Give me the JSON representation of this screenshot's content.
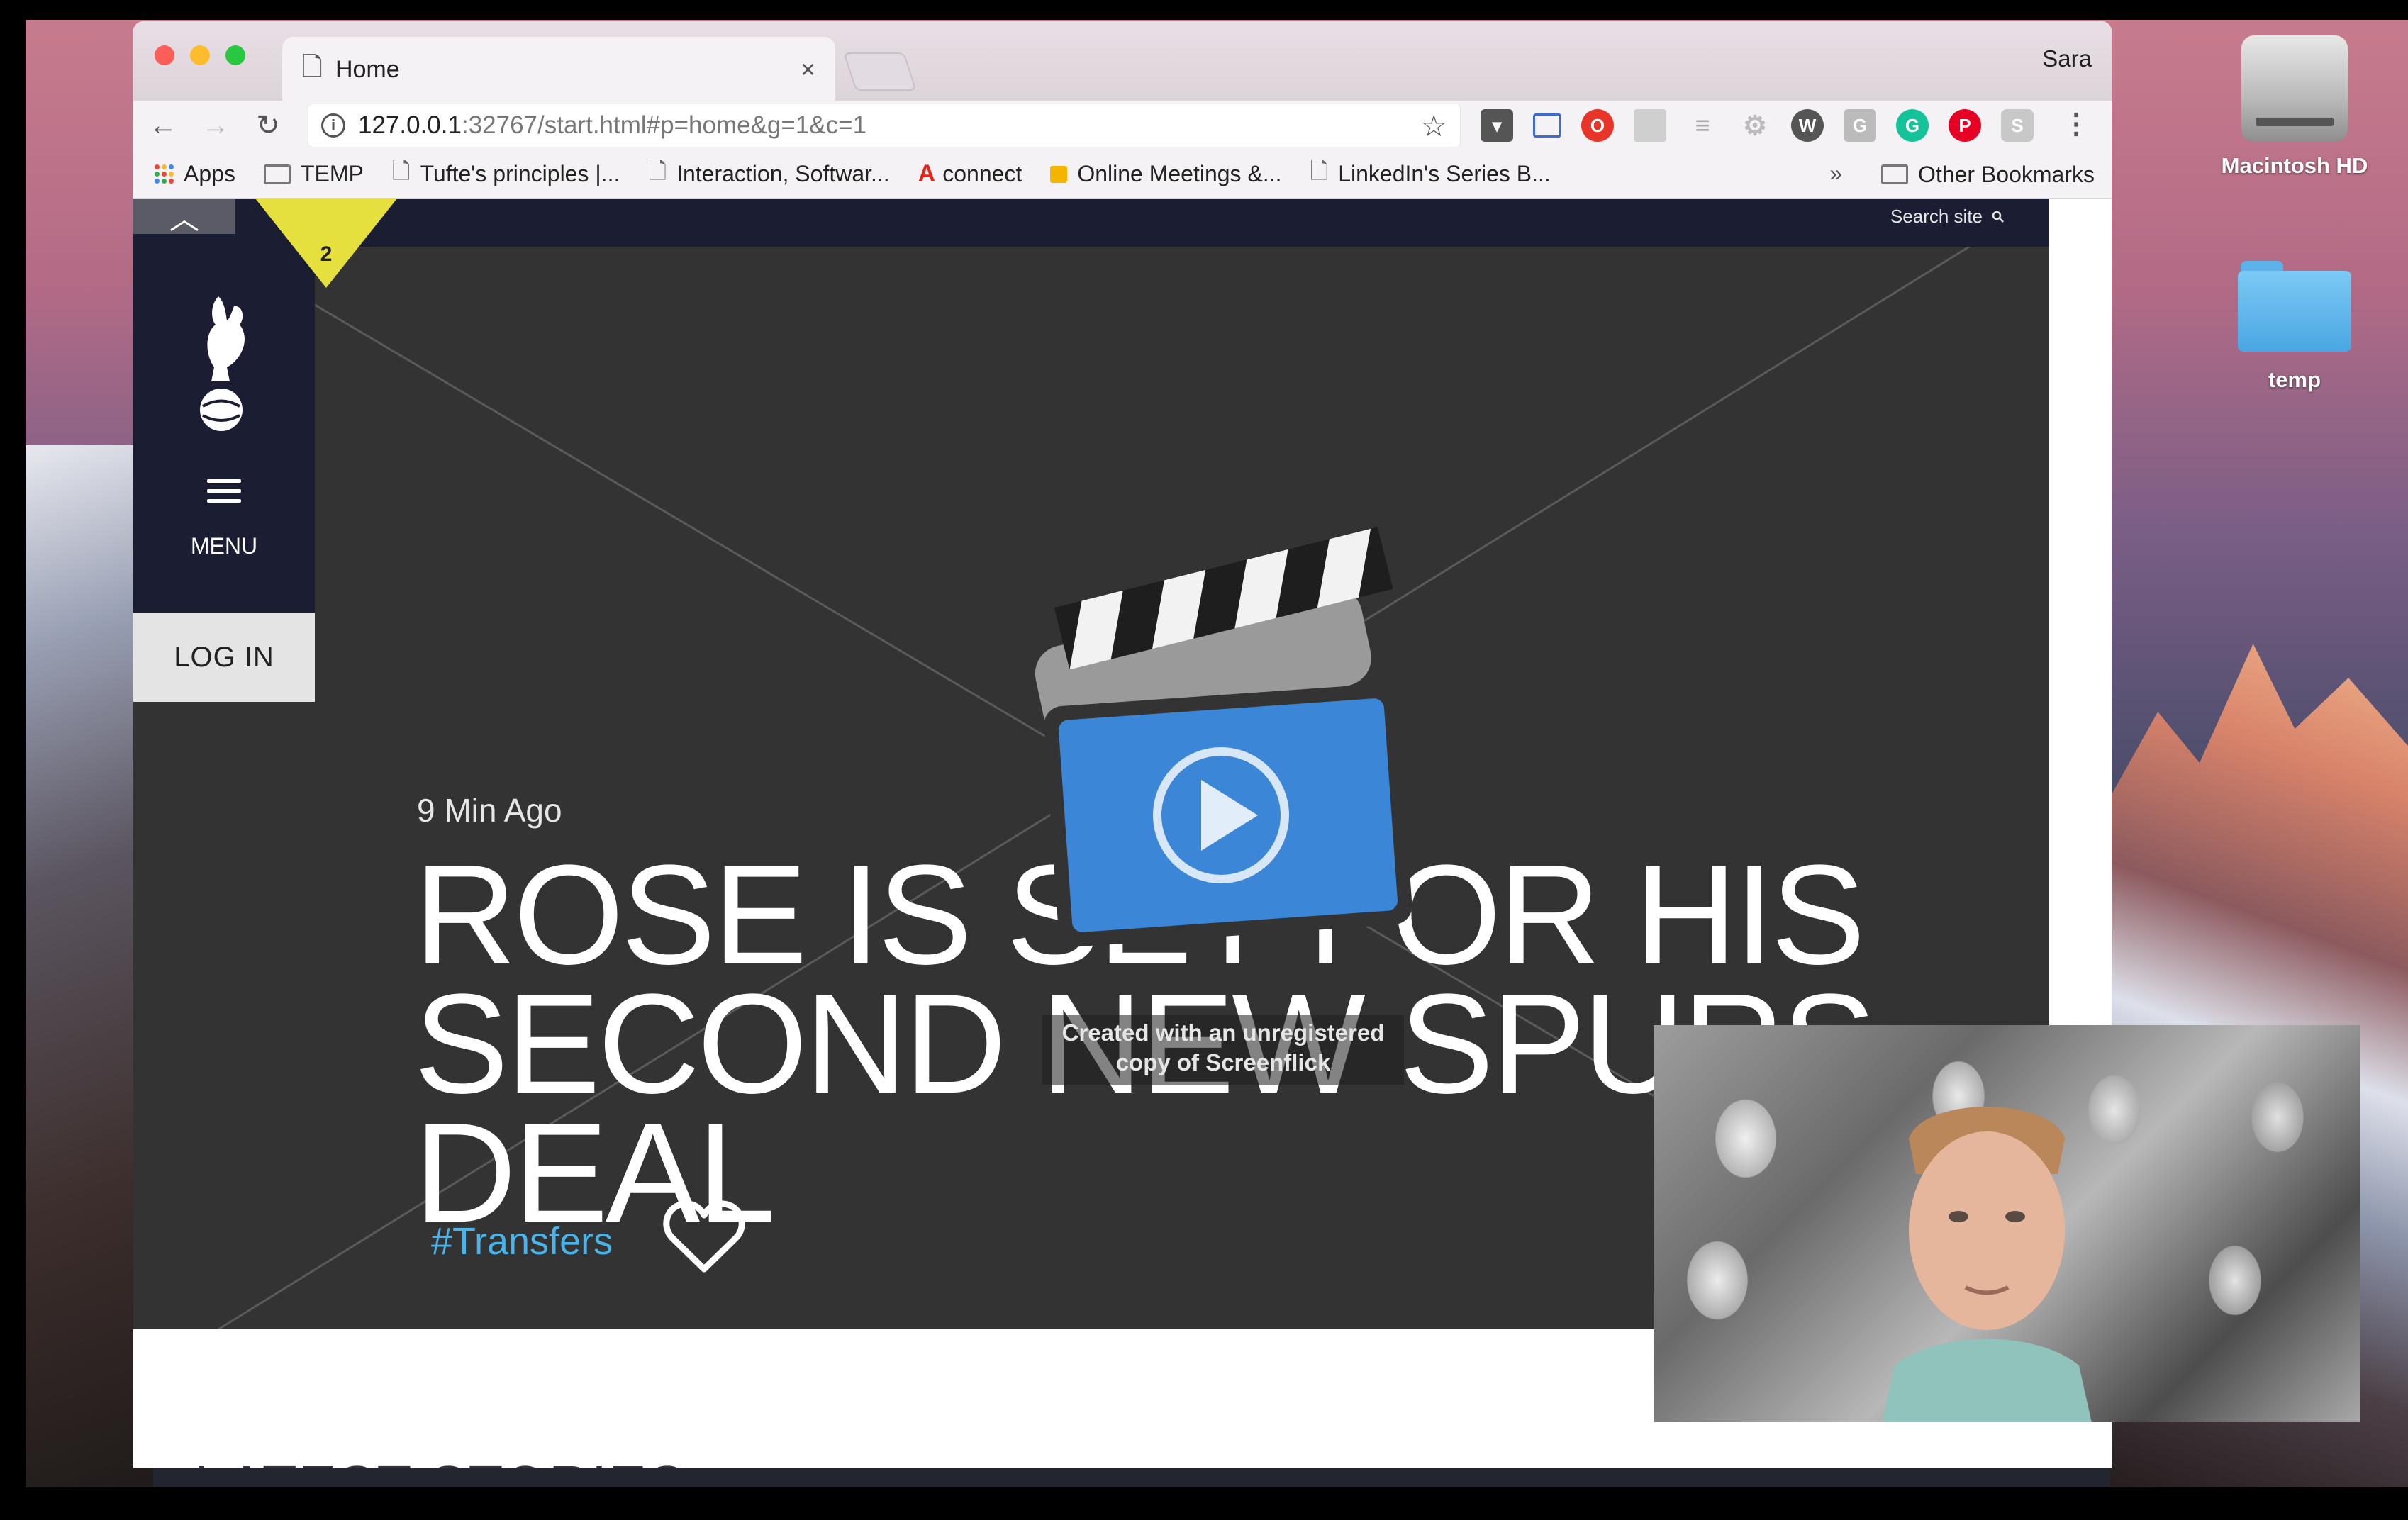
{
  "browser": {
    "tab_title": "Home",
    "tab_close": "×",
    "profile_name": "Sara",
    "url_host": "127.0.0.1",
    "url_rest": ":32767/start.html#p=home&g=1&c=1",
    "bookmarks": [
      {
        "label": "Apps",
        "icon": "apps-grid-icon"
      },
      {
        "label": "TEMP",
        "icon": "folder-icon"
      },
      {
        "label": "Tufte's principles |...",
        "icon": "page-icon"
      },
      {
        "label": "Interaction, Softwar...",
        "icon": "page-icon"
      },
      {
        "label": "connect",
        "icon": "adobe-icon"
      },
      {
        "label": "Online Meetings &...",
        "icon": "meetings-icon"
      },
      {
        "label": "LinkedIn's Series B...",
        "icon": "page-icon"
      }
    ],
    "bookmarks_more": "»",
    "other_bookmarks": "Other Bookmarks",
    "extensions": [
      "pocket-icon",
      "screenshot-icon",
      "opera-icon",
      "layout-icon",
      "align-icon",
      "gear-icon",
      "wordpress-icon",
      "g-icon",
      "grammarly-icon",
      "pinterest-icon",
      "s-icon"
    ]
  },
  "desktop": {
    "icons": [
      {
        "label": "Macintosh HD",
        "icon": "hard-drive-icon"
      },
      {
        "label": "temp",
        "icon": "folder-icon"
      }
    ]
  },
  "site": {
    "search_label": "Search site",
    "notification_count": "2",
    "menu_label": "MENU",
    "login_label": "LOG IN",
    "article": {
      "time_ago": "9 Min Ago",
      "headline_line1": "ROSE IS SET FOR HIS",
      "headline_line2": "SECOND NEW SPURS DEAL",
      "tag": "#Transfers"
    },
    "latest_heading": "LATEST STORIES"
  },
  "watermark": {
    "line1": "Created with an unregistered",
    "line2": "copy of Screenflick"
  },
  "colors": {
    "nav_dark": "#1b1d33",
    "hero_bg": "#333333",
    "badge_yellow": "#e5e03d",
    "tag_blue": "#4ab4ea"
  }
}
